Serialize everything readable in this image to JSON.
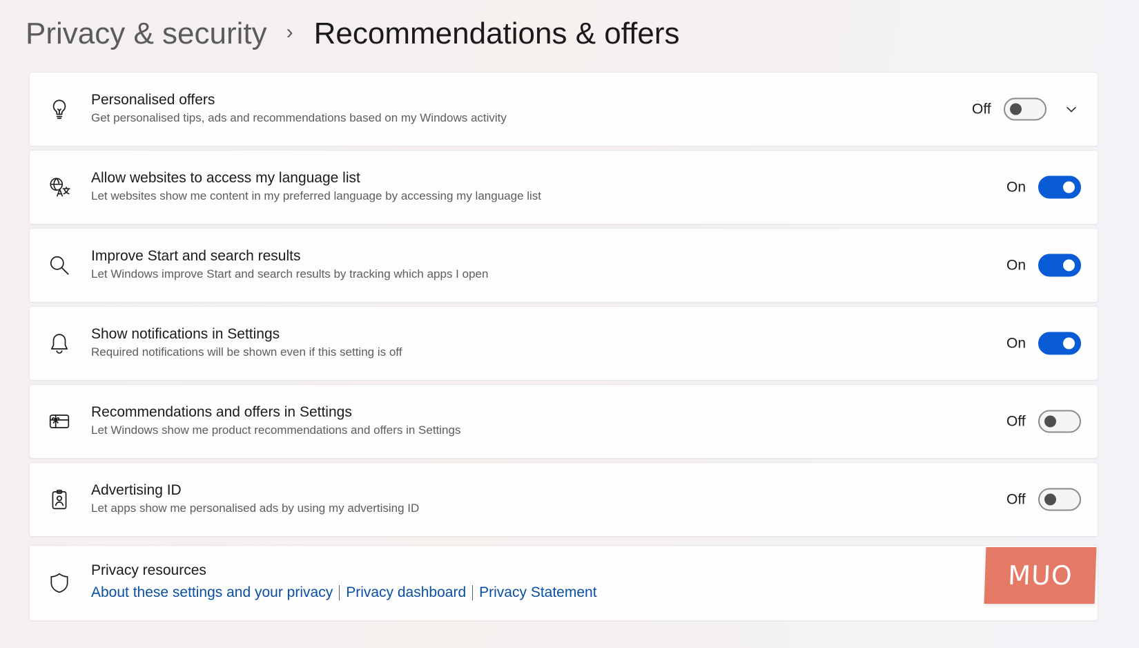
{
  "breadcrumb": {
    "parent": "Privacy & security",
    "separator": "›",
    "current": "Recommendations & offers"
  },
  "settings": [
    {
      "icon": "lightbulb-icon",
      "title": "Personalised offers",
      "description": "Get personalised tips, ads and recommendations based on my Windows activity",
      "state_label": "Off",
      "enabled": false,
      "expandable": true
    },
    {
      "icon": "language-icon",
      "title": "Allow websites to access my language list",
      "description": "Let websites show me content in my preferred language by accessing my language list",
      "state_label": "On",
      "enabled": true,
      "expandable": false
    },
    {
      "icon": "search-icon",
      "title": "Improve Start and search results",
      "description": "Let Windows improve Start and search results by tracking which apps I open",
      "state_label": "On",
      "enabled": true,
      "expandable": false
    },
    {
      "icon": "bell-icon",
      "title": "Show notifications in Settings",
      "description": "Required notifications will be shown even if this setting is off",
      "state_label": "On",
      "enabled": true,
      "expandable": false
    },
    {
      "icon": "gift-card-icon",
      "title": "Recommendations and offers in Settings",
      "description": "Let Windows show me product recommendations and offers in Settings",
      "state_label": "Off",
      "enabled": false,
      "expandable": false
    },
    {
      "icon": "id-badge-icon",
      "title": "Advertising ID",
      "description": "Let apps show me personalised ads by using my advertising ID",
      "state_label": "Off",
      "enabled": false,
      "expandable": false
    }
  ],
  "resources": {
    "icon": "shield-icon",
    "title": "Privacy resources",
    "links": [
      "About these settings and your privacy",
      "Privacy dashboard",
      "Privacy Statement"
    ]
  },
  "watermark": {
    "text": "MUO",
    "color": "#e47966"
  },
  "colors": {
    "accent": "#0a5bd6",
    "link": "#0a4fa6"
  }
}
